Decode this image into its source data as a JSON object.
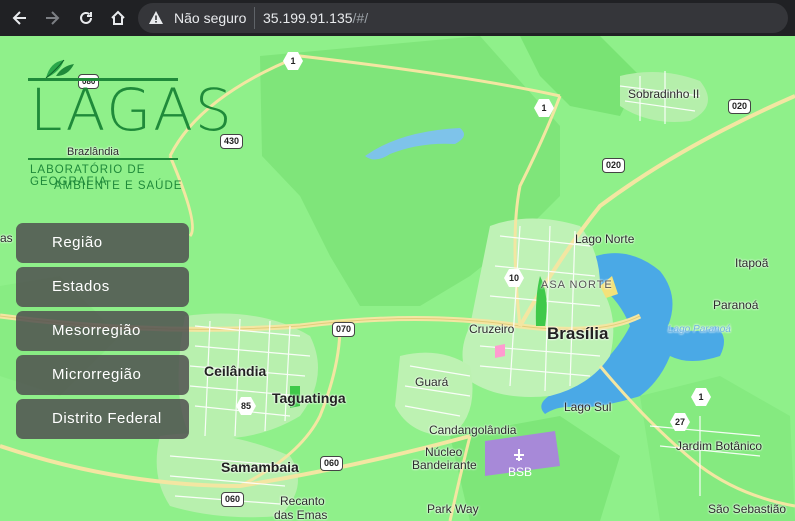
{
  "browser": {
    "security_label": "Não seguro",
    "url_host": "35.199.91.135",
    "url_path": "/#/"
  },
  "logo": {
    "wordmark": "LAGAS",
    "line1": "LABORATÓRIO DE GEOGRAFIA",
    "line2": "AMBIENTE E SAÚDE"
  },
  "menu": {
    "items": [
      {
        "label": "Região"
      },
      {
        "label": "Estados"
      },
      {
        "label": "Mesorregião"
      },
      {
        "label": "Microrregião"
      },
      {
        "label": "Distrito Federal"
      }
    ]
  },
  "map": {
    "places": {
      "brasilia": "Brasília",
      "asa_norte": "ASA NORTE",
      "lago_norte": "Lago Norte",
      "lago_sul": "Lago Sul",
      "cruzeiro": "Cruzeiro",
      "guara": "Guará",
      "ceilandia": "Ceilândia",
      "taguatinga": "Taguatinga",
      "samambaia": "Samambaia",
      "candangolandia": "Candangolândia",
      "nucleo_bandeirante_1": "Núcleo",
      "nucleo_bandeirante_2": "Bandeirante",
      "recanto_1": "Recanto",
      "recanto_2": "das Emas",
      "park_way": "Park Way",
      "jardim_botanico": "Jardim Botânico",
      "sao_sebastiao": "São Sebastião",
      "itapoa": "Itapoã",
      "paranoa": "Paranoá",
      "sobradinho": "Sobradinho II",
      "lago_paranoa": "Lago Paranoá",
      "brazlandia": "Brazlândia",
      "airport": "BSB",
      "edge_as": "as"
    },
    "roads": {
      "r1a": "1",
      "r1b": "1",
      "r020a": "020",
      "r020b": "020",
      "r430": "430",
      "r10": "10",
      "r070": "070",
      "r85": "85",
      "r060a": "060",
      "r060b": "060",
      "r27": "27",
      "r1c": "1",
      "r080": "080"
    }
  }
}
